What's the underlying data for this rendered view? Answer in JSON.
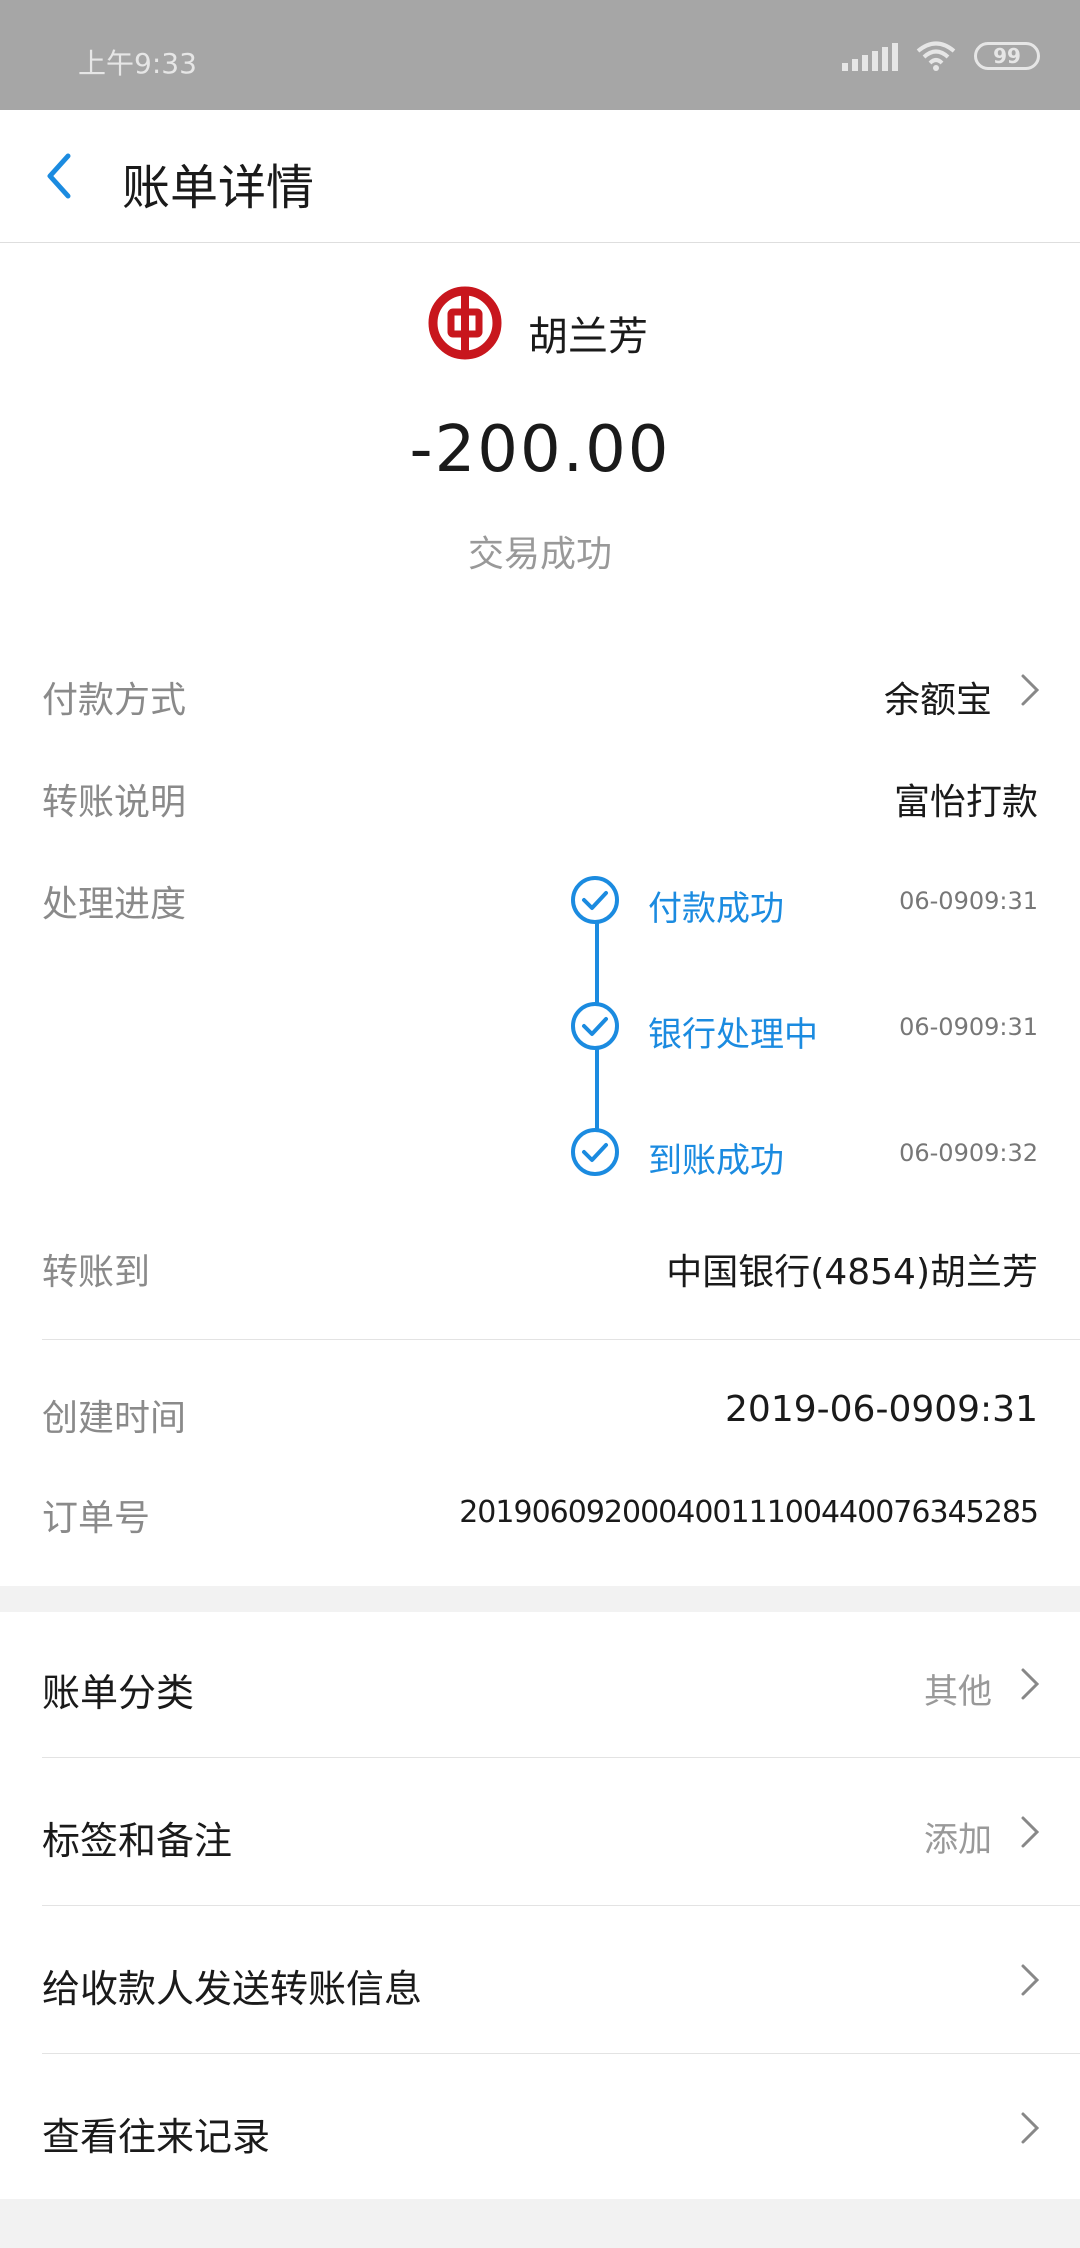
{
  "status_bar": {
    "time": "上午9:33",
    "battery": "99"
  },
  "header": {
    "title": "账单详情"
  },
  "payee": {
    "name": "胡兰芳"
  },
  "amount": "-200.00",
  "transaction_status": "交易成功",
  "details": {
    "payment_method": {
      "label": "付款方式",
      "value": "余额宝"
    },
    "transfer_note": {
      "label": "转账说明",
      "value": "富怡打款"
    },
    "progress": {
      "label": "处理进度",
      "steps": [
        {
          "label": "付款成功",
          "time": "06-0909:31"
        },
        {
          "label": "银行处理中",
          "time": "06-0909:31"
        },
        {
          "label": "到账成功",
          "time": "06-0909:32"
        }
      ]
    },
    "transfer_to": {
      "label": "转账到",
      "value": "中国银行(4854)胡兰芳"
    },
    "created_time": {
      "label": "创建时间",
      "value": "2019-06-0909:31"
    },
    "order_number": {
      "label": "订单号",
      "value": "20190609200040011100440076345285"
    }
  },
  "menu": [
    {
      "label": "账单分类",
      "value": "其他"
    },
    {
      "label": "标签和备注",
      "value": "添加"
    },
    {
      "label": "给收款人发送转账信息",
      "value": ""
    },
    {
      "label": "查看往来记录",
      "value": ""
    }
  ],
  "colors": {
    "accent": "#1b8be0",
    "bank_red": "#c8161d",
    "status_bar": "#a6a6a6"
  },
  "icons": [
    "back-arrow-icon",
    "bank-of-china-logo",
    "chevron-right-icon",
    "check-circle-icon",
    "signal-icon",
    "wifi-icon",
    "battery-icon"
  ]
}
